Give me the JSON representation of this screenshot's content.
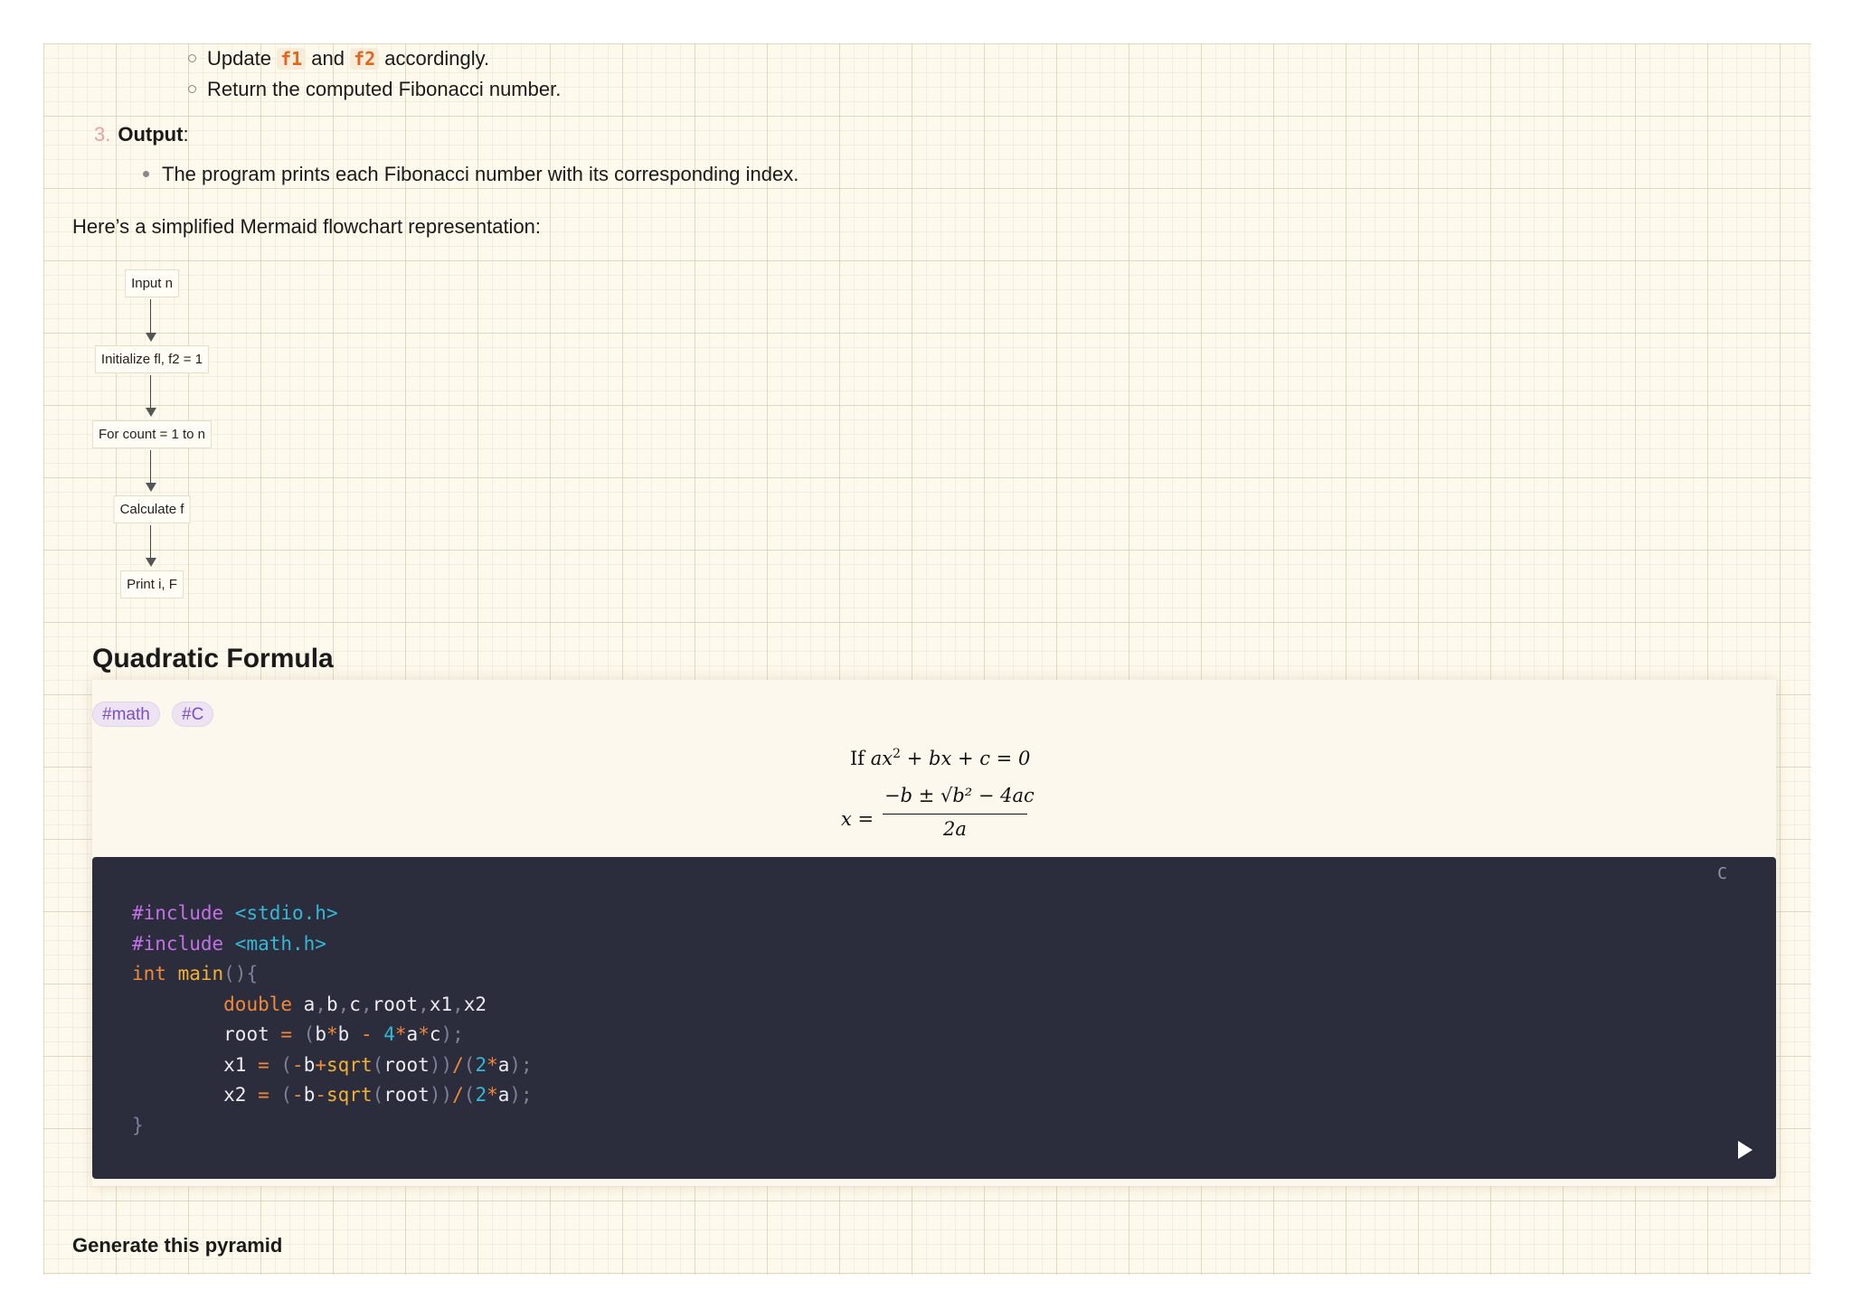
{
  "list": {
    "sub_items": [
      {
        "parts": [
          "Update ",
          "f1",
          " and ",
          "f2",
          " accordingly."
        ]
      },
      {
        "text": "Return the computed Fibonacci number."
      }
    ],
    "output_number": "3.",
    "output_label": "Output",
    "output_colon": ":",
    "output_bullet": "The program prints each Fibonacci number with its corresponding index."
  },
  "intro": "Here’s a simplified Mermaid flowchart representation:",
  "flowchart": {
    "nodes": [
      "Input n",
      "Initialize fl, f2 = 1",
      "For count = 1 to n",
      "Calculate f",
      "Print i, F"
    ]
  },
  "quadratic": {
    "title": "Quadratic Formula",
    "tags": [
      "#math",
      "#C"
    ],
    "eq1": {
      "if": "If",
      "lhs_a": "ax",
      "sup": "2",
      "rest": " + bx + c = 0"
    },
    "eq2": {
      "x": "x =",
      "num": "−b ± √b² − 4ac",
      "den": "2a"
    },
    "code_lang": "C",
    "code": {
      "l1a": "#include",
      "l1b": " <stdio.h>",
      "l2a": "#include",
      "l2b": " <math.h>",
      "l3a": "int",
      "l3b": " main",
      "l3c": "(){",
      "l4a": "double",
      "l4b": " a",
      "l4c": ",",
      "l4d": "b",
      "l4e": ",",
      "l4f": "c",
      "l4g": ",",
      "l4h": "root",
      "l4i": ",",
      "l4j": "x1",
      "l4k": ",",
      "l4l": "x2",
      "l5a": "root",
      "l5b": " = ",
      "l5c": "(",
      "l5d": "b",
      "l5e": "*",
      "l5f": "b",
      "l5g": " - ",
      "l5h": "4",
      "l5i": "*",
      "l5j": "a",
      "l5k": "*",
      "l5l": "c",
      "l5m": ");",
      "l6a": "x1",
      "l6b": " = ",
      "l6c": "(",
      "l6d": "-",
      "l6e": "b",
      "l6f": "+",
      "l6g": "sqrt",
      "l6h": "(",
      "l6i": "root",
      "l6j": "))",
      "l6k": "/",
      "l6l": "(",
      "l6m": "2",
      "l6n": "*",
      "l6o": "a",
      "l6p": ");",
      "l7a": "x2",
      "l7b": " = ",
      "l7c": "(",
      "l7d": "-",
      "l7e": "b",
      "l7f": "-",
      "l7g": "sqrt",
      "l7h": "(",
      "l7i": "root",
      "l7j": "))",
      "l7k": "/",
      "l7l": "(",
      "l7m": "2",
      "l7n": "*",
      "l7o": "a",
      "l7p": ");",
      "l8": "}"
    }
  },
  "next_heading": "Generate this pyramid"
}
